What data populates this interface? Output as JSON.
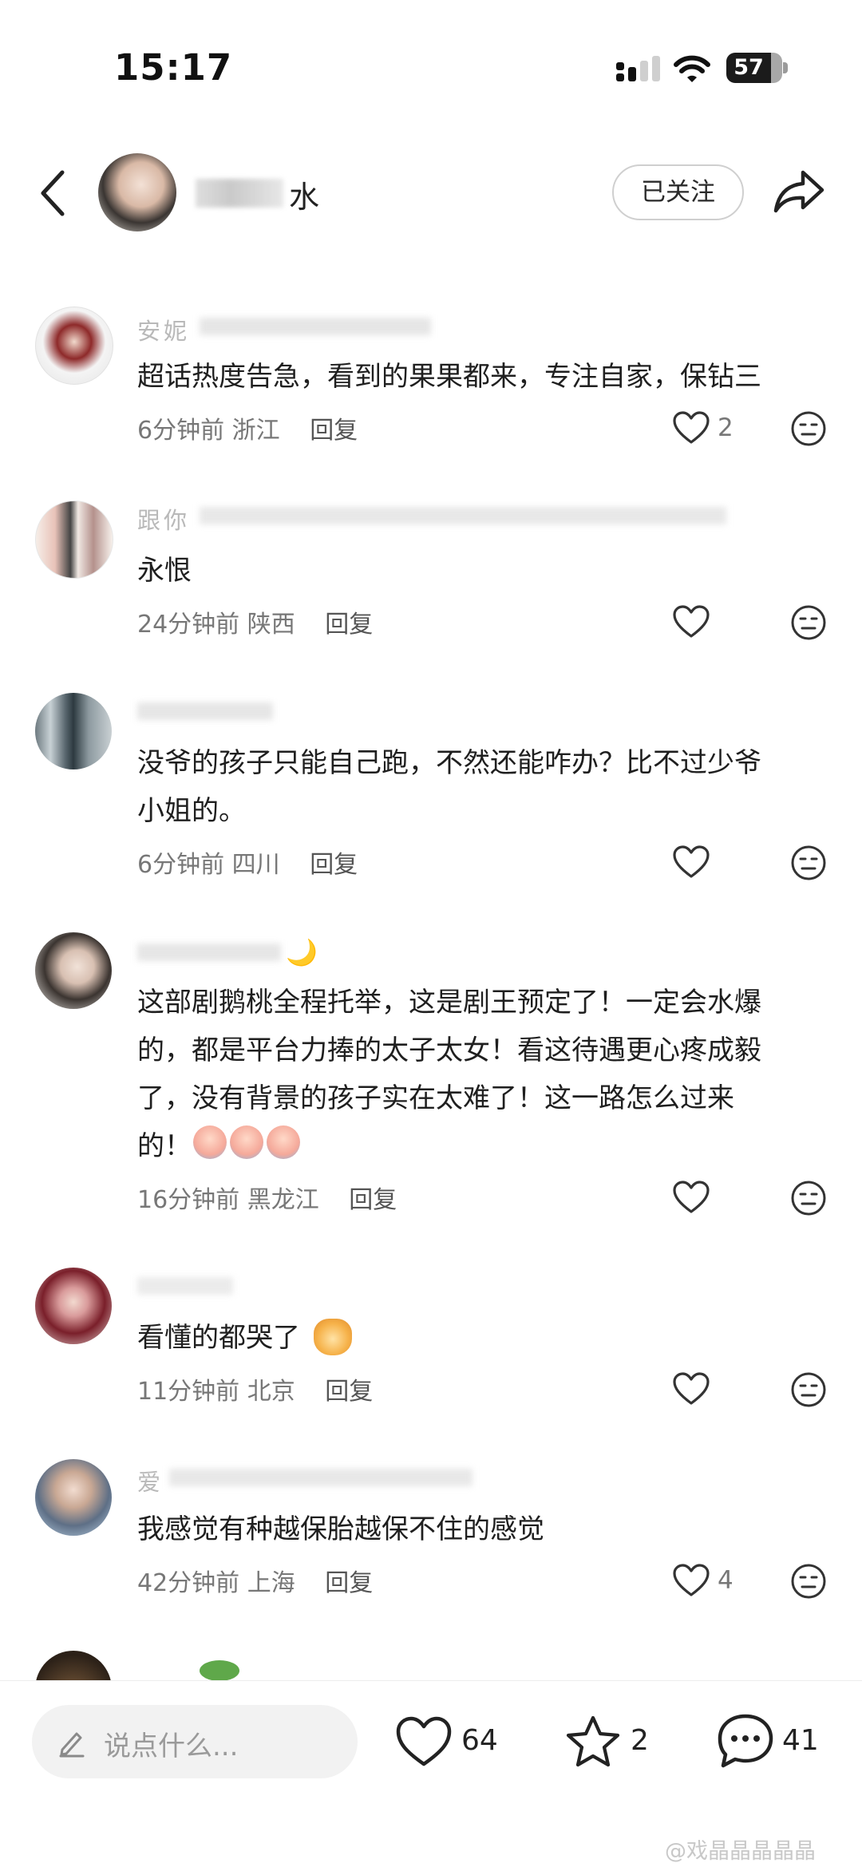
{
  "status_bar": {
    "time": "15:17",
    "battery": "57"
  },
  "header": {
    "author_name": "水",
    "follow_label": "已关注"
  },
  "comments": [
    {
      "user": "安妮",
      "text": "超话热度告急，看到的果果都来，专注自家，保钻三",
      "time": "6分钟前",
      "location": "浙江",
      "reply": "回复",
      "likes": "2"
    },
    {
      "user": "跟你",
      "text": "永恨",
      "time": "24分钟前",
      "location": "陕西",
      "reply": "回复",
      "likes": ""
    },
    {
      "user": "",
      "text": "没爷的孩子只能自己跑，不然还能咋办？比不过少爷\n小姐的。",
      "time": "6分钟前",
      "location": "四川",
      "reply": "回复",
      "likes": ""
    },
    {
      "user": "",
      "text": "这部剧鹅桃全程托举，这是剧王预定了！一定会水爆\n的，都是平台力捧的太子太女！看这待遇更心疼成毅\n了，没有背景的孩子实在太难了！这一路怎么过来\n的！",
      "time": "16分钟前",
      "location": "黑龙江",
      "reply": "回复",
      "likes": ""
    },
    {
      "user": "",
      "text": "看懂的都哭了",
      "time": "11分钟前",
      "location": "北京",
      "reply": "回复",
      "likes": ""
    },
    {
      "user": "爱",
      "text": "我感觉有种越保胎越保不住的感觉",
      "time": "42分钟前",
      "location": "上海",
      "reply": "回复",
      "likes": "4"
    }
  ],
  "bottom_bar": {
    "input_placeholder": "说点什么...",
    "likes": "64",
    "stars": "2",
    "comments": "41"
  },
  "watermark": "@戏晶晶晶晶晶",
  "colors": {
    "background": "#ffffff",
    "meta_text": "#777777",
    "icon_stroke": "#333333"
  },
  "icons": [
    "back-icon",
    "share-icon",
    "heart-icon",
    "dislike-face-icon",
    "pencil-icon",
    "star-icon",
    "comment-bubble-icon",
    "signal-icon",
    "wifi-icon"
  ]
}
